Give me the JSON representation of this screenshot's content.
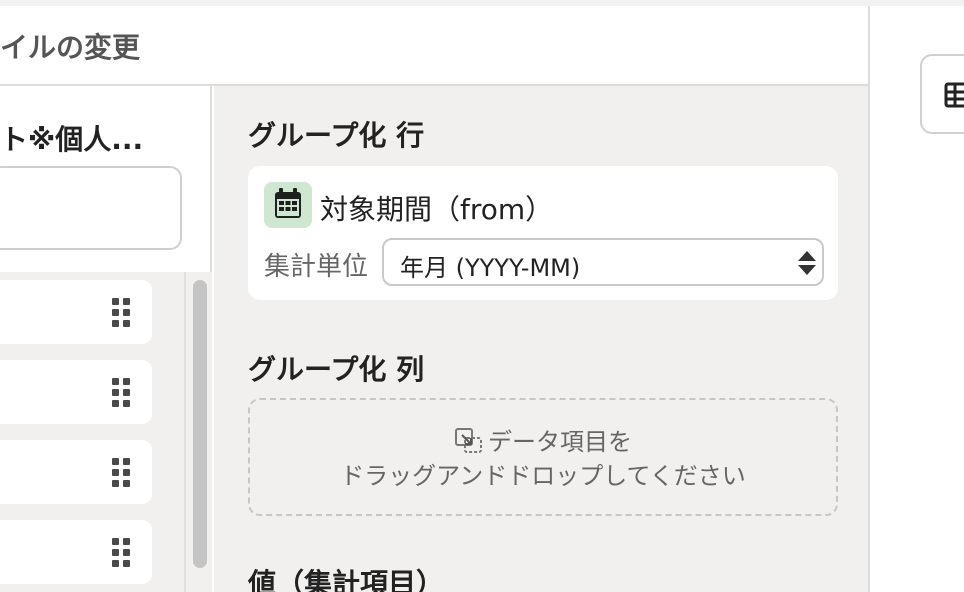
{
  "header": {
    "title": "イルの変更"
  },
  "left_panel": {
    "heading": "ト※個人..."
  },
  "group_rows": {
    "title": "グループ化 行",
    "field": {
      "icon": "calendar-icon",
      "name": "対象期間（from）",
      "unit_label": "集計単位",
      "unit_value": "年月 (YYYY-MM)"
    }
  },
  "group_cols": {
    "title": "グループ化 列",
    "drop_line1": "データ項目を",
    "drop_line2": "ドラッグアンドドロップしてください"
  },
  "values": {
    "title": "値（集計項目）"
  },
  "colors": {
    "calendar_badge": "#cfe6d0",
    "panel_bg": "#f1f0ee"
  }
}
